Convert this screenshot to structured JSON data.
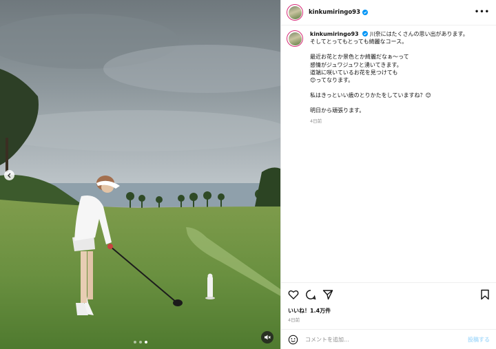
{
  "post": {
    "username": "kinkumiringo93",
    "more_label": "•••",
    "caption": {
      "username": "kinkumiringo93",
      "lines": [
        "川奈にはたくさんの思い出があります。",
        "そしてとってもとっても綺麗なコース。",
        "",
        "最近お花とか景色とか綺麗だなぁ～って",
        "感情がジュワジュワと湧いてきます。",
        "道端に咲いているお花を見つけても",
        "😊ってなります。",
        "",
        "私はきっといい歳のとりかたをしていますね？😊",
        "",
        "明日から頑張ります。"
      ],
      "time": "4日前"
    },
    "likes": "いいね！1.4万件",
    "time": "4日前",
    "comment": {
      "placeholder": "コメントを追加...",
      "value": "",
      "post_label": "投稿する"
    },
    "carousel": {
      "count": 3,
      "active_index": 2
    },
    "colors": {
      "verified": "#0095f6",
      "avatar_ring": "#d62976",
      "post_button": "#b2dffc"
    },
    "icons": [
      "chevron-left-icon",
      "mute-icon",
      "heart-icon",
      "comment-icon",
      "share-icon",
      "bookmark-icon",
      "emoji-icon",
      "verified-icon",
      "more-icon"
    ]
  }
}
